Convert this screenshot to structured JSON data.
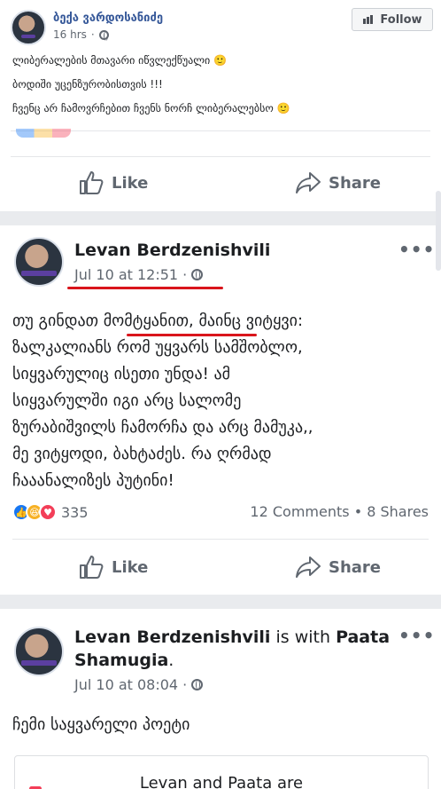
{
  "top_post": {
    "author": "ბექა ვარდოსანიძე",
    "time": "16 hrs",
    "follow_label": "Follow",
    "lines": [
      "ლიბერალების მთავარი იწვლექწუალი 🙂",
      "ბოდიში უცენზურობისთვის !!!",
      "ჩვენც არ ჩამოვრჩებით ჩვენს ნორჩ ლიბერალებსო 🙂"
    ],
    "like_label": "Like",
    "share_label": "Share"
  },
  "post1": {
    "author": "Levan Berdzenishvili",
    "time": "Jul 10 at 12:51",
    "separator": "·",
    "body_lines": [
      "თუ გინდათ მომტყანით, მაინც ვიტყვი:",
      "ზალკალიანს რომ უყვარს სამშობლო,",
      "სიყვარულიც ისეთი უნდა! ამ",
      "სიყვარულში იგი არც სალომე",
      "ზურაბიშვილს ჩამორჩა და არც მამუკა,,",
      "მე ვიტყოდი, ბახტაძეს. რა ღრმად",
      "ჩააანალიზეს პუტინი!"
    ],
    "reaction_count": "335",
    "comments": "12 Comments",
    "shares": "8 Shares",
    "counts_sep": "•",
    "like_label": "Like",
    "share_label": "Share",
    "more": "•••"
  },
  "post2": {
    "author": "Levan Berdzenishvili",
    "with_text": "is with",
    "tagged": "Paata",
    "tagged_line2": "Shamugia",
    "period": ".",
    "time": "Jul 10 at 08:04",
    "separator": "·",
    "body": "ჩემი საყვარელი პოეტი",
    "attachment_title": "Levan and Paata are",
    "more": "•••"
  },
  "colors": {
    "link": "#365899",
    "underline": "#d9151c",
    "like_blue": "#1877f2",
    "haha_yellow": "#f7b125",
    "love_red": "#f33e58"
  },
  "icons": [
    "thumbs-up-icon",
    "share-arrow-icon",
    "globe-icon",
    "follow-icon"
  ]
}
